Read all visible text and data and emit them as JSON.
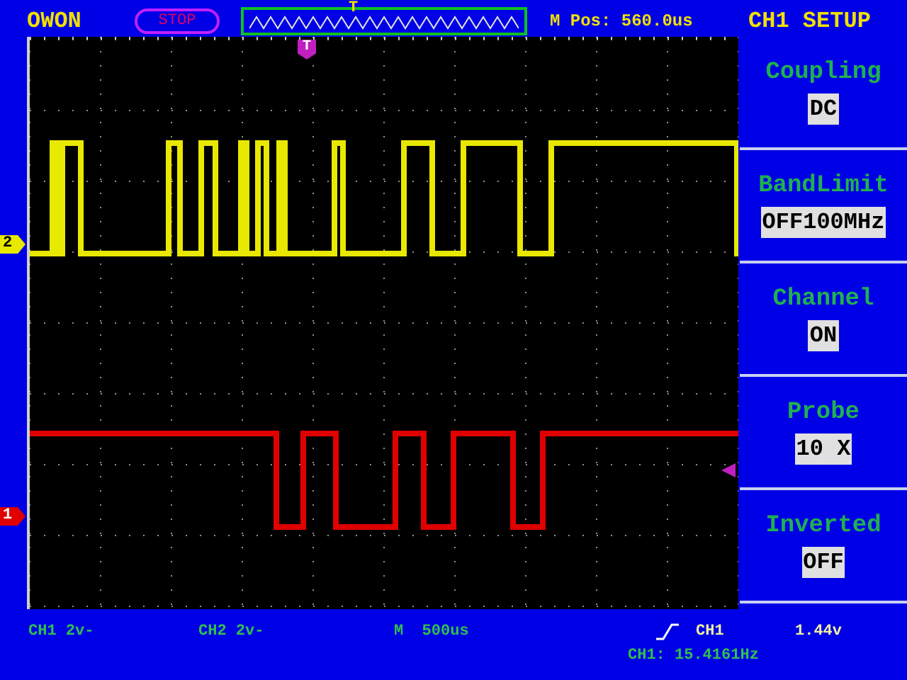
{
  "brand": "OWON",
  "run_state": {
    "label": "STOP"
  },
  "overview": {
    "trigger_mark": "T"
  },
  "m_pos": "M Pos: 560.0us",
  "menu_title": "CH1 SETUP",
  "trigger_marker": "T",
  "channel_markers": [
    {
      "label": "2",
      "color": "#e8e800"
    },
    {
      "label": "1",
      "color": "#e00000"
    }
  ],
  "menu": [
    {
      "label": "Coupling",
      "value": "DC"
    },
    {
      "label": "BandLimit",
      "value": "OFF100MHz"
    },
    {
      "label": "Channel",
      "value": "ON"
    },
    {
      "label": "Probe",
      "value": "10 X"
    },
    {
      "label": "Inverted",
      "value": "OFF"
    }
  ],
  "status": {
    "ch1_scale": "CH1 2v-",
    "ch2_scale": "CH2 2v-",
    "timebase": "M  500us",
    "trigger_source": "CH1",
    "trigger_level": "1.44v",
    "frequency": "CH1: 15.4161Hz"
  }
}
